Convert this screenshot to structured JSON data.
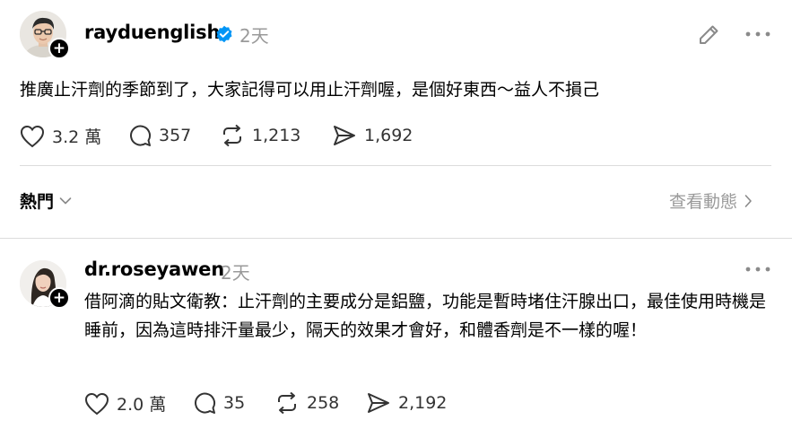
{
  "post": {
    "username": "rayduenglish",
    "time": "2天",
    "text": "推廣止汗劑的季節到了，大家記得可以用止汗劑喔，是個好東西～益人不損己",
    "likes": "3.2 萬",
    "replies": "357",
    "reposts": "1,213",
    "shares": "1,692"
  },
  "filter": {
    "label": "熱門",
    "view_activity": "查看動態"
  },
  "reply": {
    "username": "dr.roseyawen",
    "time": "2天",
    "text": "借阿滴的貼文衛教：止汗劑的主要成分是鋁鹽，功能是暫時堵住汗腺出口，最佳使用時機是睡前，因為這時排汗量最少，隔天的效果才會好，和體香劑是不一樣的喔！",
    "likes": "2.0 萬",
    "replies": "35",
    "reposts": "258",
    "shares": "2,192"
  },
  "icons": {
    "verified": "verified-badge-icon",
    "edit": "pencil-icon",
    "more": "more-dots-icon",
    "like": "heart-icon",
    "reply": "comment-icon",
    "repost": "repost-icon",
    "share": "share-icon",
    "chevron_down": "chevron-down-icon",
    "chevron_right": "chevron-right-icon",
    "follow": "plus-icon"
  },
  "colors": {
    "verified": "#0095f6",
    "muted": "#9a9a9a",
    "divider": "#dcdcdc"
  }
}
